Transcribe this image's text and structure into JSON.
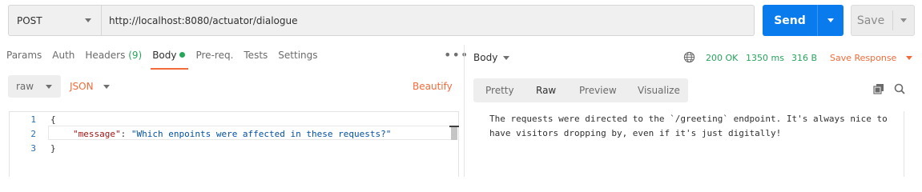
{
  "request": {
    "method": "POST",
    "url": "http://localhost:8080/actuator/dialogue",
    "send_label": "Send",
    "save_label": "Save"
  },
  "request_tabs": {
    "params": "Params",
    "auth": "Auth",
    "headers": "Headers",
    "headers_count": "(9)",
    "body": "Body",
    "prereq": "Pre-req.",
    "tests": "Tests",
    "settings": "Settings",
    "more": "•••"
  },
  "body_controls": {
    "mode": "raw",
    "format": "JSON",
    "beautify": "Beautify"
  },
  "editor": {
    "line_numbers": [
      "1",
      "2",
      "3"
    ],
    "open_brace": "{",
    "key": "\"message\"",
    "colon": ": ",
    "value": "\"Which enpoints were affected in these requests?\"",
    "close_brace": "}"
  },
  "response": {
    "label": "Body",
    "status": "200 OK",
    "time": "1350 ms",
    "size": "316 B",
    "save_response": "Save Response",
    "view_tabs": [
      "Pretty",
      "Raw",
      "Preview",
      "Visualize"
    ],
    "text": "The requests were directed to the `/greeting` endpoint. It's always nice to have visitors dropping by, even if it's just digitally!"
  },
  "colors": {
    "accent_orange": "#f26b3a",
    "send_blue": "#097bed",
    "status_green": "#26a65b"
  },
  "icons": [
    "chevron-down-icon",
    "globe-icon",
    "copy-icon",
    "search-icon",
    "more-options-icon"
  ]
}
